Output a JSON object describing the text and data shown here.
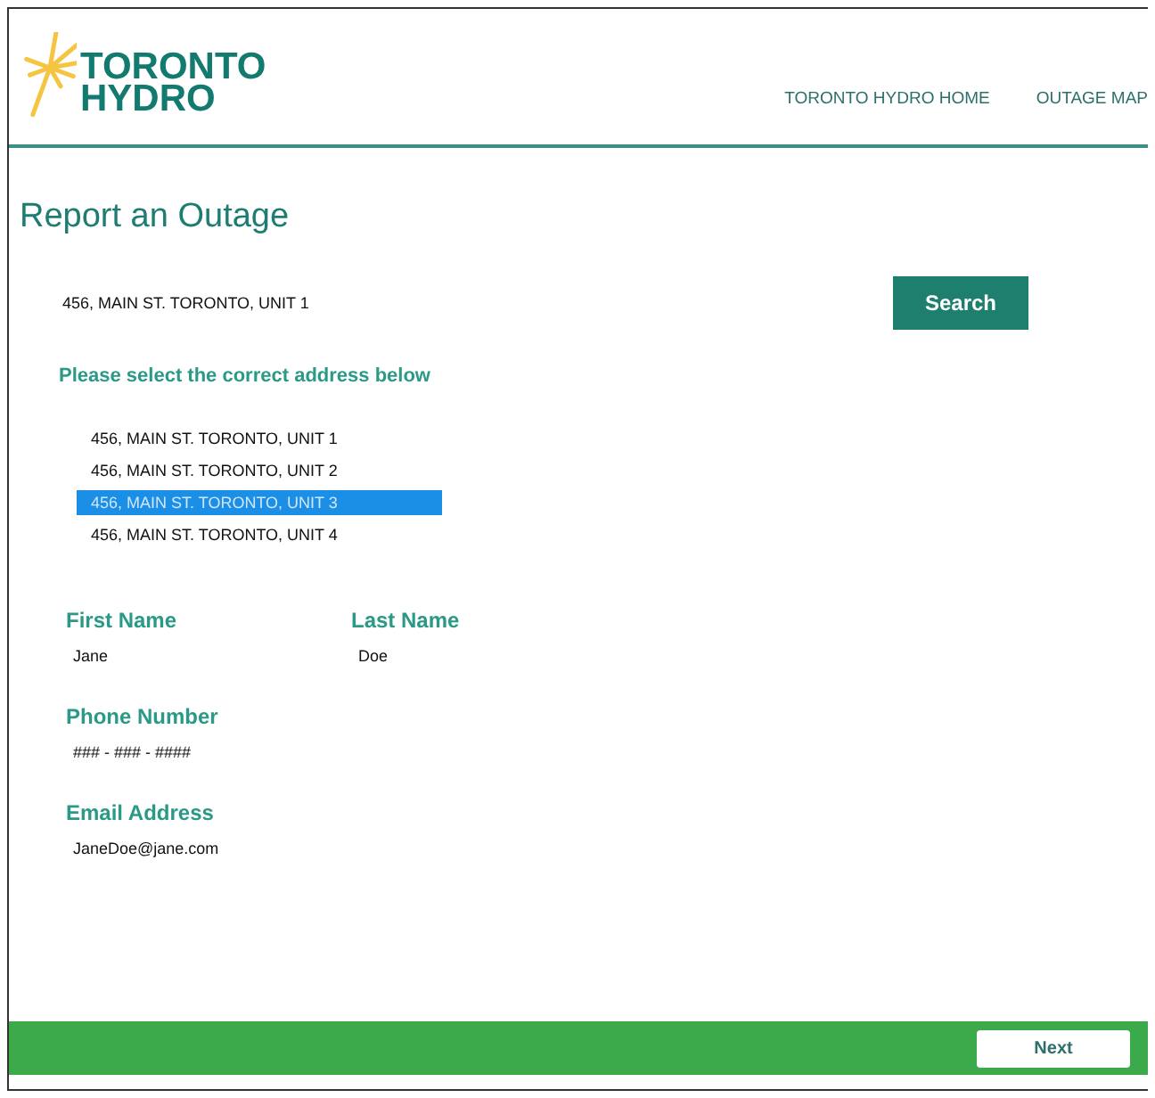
{
  "header": {
    "logo_lines": [
      "TORONTO",
      "HYDRO"
    ],
    "nav": [
      {
        "label": "TORONTO HYDRO HOME"
      },
      {
        "label": "OUTAGE MAP"
      }
    ]
  },
  "page_title": "Report an Outage",
  "search": {
    "value": "456, MAIN ST. TORONTO, UNIT 1",
    "button": "Search"
  },
  "address_prompt": "Please select the correct address below",
  "addresses": [
    {
      "label": "456, MAIN ST. TORONTO, UNIT 1",
      "selected": false
    },
    {
      "label": "456, MAIN ST. TORONTO, UNIT 2",
      "selected": false
    },
    {
      "label": "456, MAIN ST. TORONTO, UNIT 3",
      "selected": true
    },
    {
      "label": "456, MAIN ST. TORONTO, UNIT 4",
      "selected": false
    }
  ],
  "fields": [
    {
      "label": "First Name",
      "value": "Jane"
    },
    {
      "label": "Last Name",
      "value": "Doe"
    },
    {
      "label": "Phone Number",
      "value": "### - ### - ####"
    },
    {
      "label": "Email Address",
      "value": "JaneDoe@jane.com"
    }
  ],
  "footer": {
    "button": "Next"
  }
}
